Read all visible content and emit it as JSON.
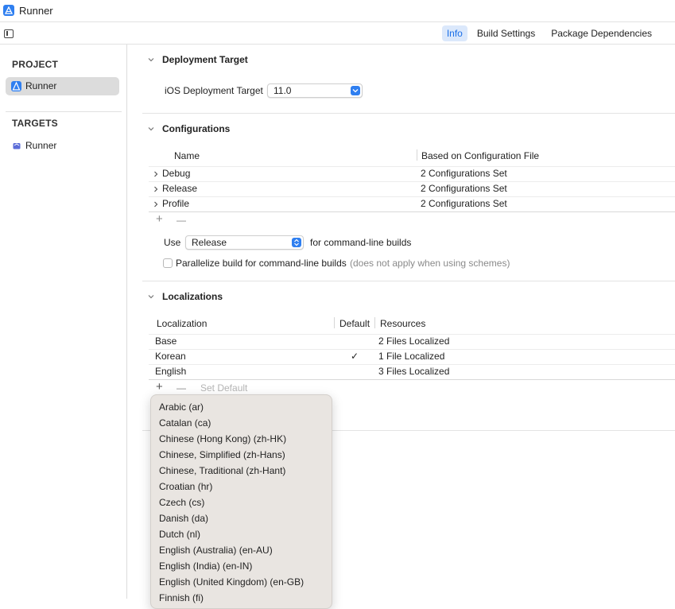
{
  "window": {
    "title": "Runner"
  },
  "toolbar": {
    "tabs": [
      {
        "label": "Info",
        "active": true
      },
      {
        "label": "Build Settings",
        "active": false
      },
      {
        "label": "Package Dependencies",
        "active": false
      }
    ]
  },
  "sidebar": {
    "project_header": "PROJECT",
    "project_item": "Runner",
    "targets_header": "TARGETS",
    "target_item": "Runner"
  },
  "deployment": {
    "title": "Deployment Target",
    "label": "iOS Deployment Target",
    "value": "11.0"
  },
  "configurations": {
    "title": "Configurations",
    "headers": {
      "name": "Name",
      "based_on": "Based on Configuration File"
    },
    "rows": [
      {
        "name": "Debug",
        "based_on": "2 Configurations Set"
      },
      {
        "name": "Release",
        "based_on": "2 Configurations Set"
      },
      {
        "name": "Profile",
        "based_on": "2 Configurations Set"
      }
    ],
    "plus": "+",
    "minus": "—",
    "use_label": "Use",
    "use_value": "Release",
    "use_suffix": "for command-line builds",
    "parallelize_label": "Parallelize build for command-line builds",
    "parallelize_hint": "(does not apply when using schemes)"
  },
  "localizations": {
    "title": "Localizations",
    "headers": {
      "localization": "Localization",
      "default": "Default",
      "resources": "Resources"
    },
    "rows": [
      {
        "name": "Base",
        "default": "",
        "resources": "2 Files Localized"
      },
      {
        "name": "Korean",
        "default": "✓",
        "resources": "1 File Localized"
      },
      {
        "name": "English",
        "default": "",
        "resources": "3 Files Localized"
      }
    ],
    "plus": "+",
    "minus": "—",
    "set_default": "Set Default"
  },
  "language_menu": {
    "items": [
      "Arabic (ar)",
      "Catalan (ca)",
      "Chinese (Hong Kong) (zh-HK)",
      "Chinese, Simplified (zh-Hans)",
      "Chinese, Traditional (zh-Hant)",
      "Croatian (hr)",
      "Czech (cs)",
      "Danish (da)",
      "Dutch (nl)",
      "English (Australia) (en-AU)",
      "English (India) (en-IN)",
      "English (United Kingdom) (en-GB)",
      "Finnish (fi)"
    ]
  },
  "colors": {
    "accent": "#2f7ff0",
    "selected_tab_bg": "#dbe8fb",
    "sidebar_selection": "#dcdcdc",
    "menu_bg": "#e9e5e1"
  }
}
